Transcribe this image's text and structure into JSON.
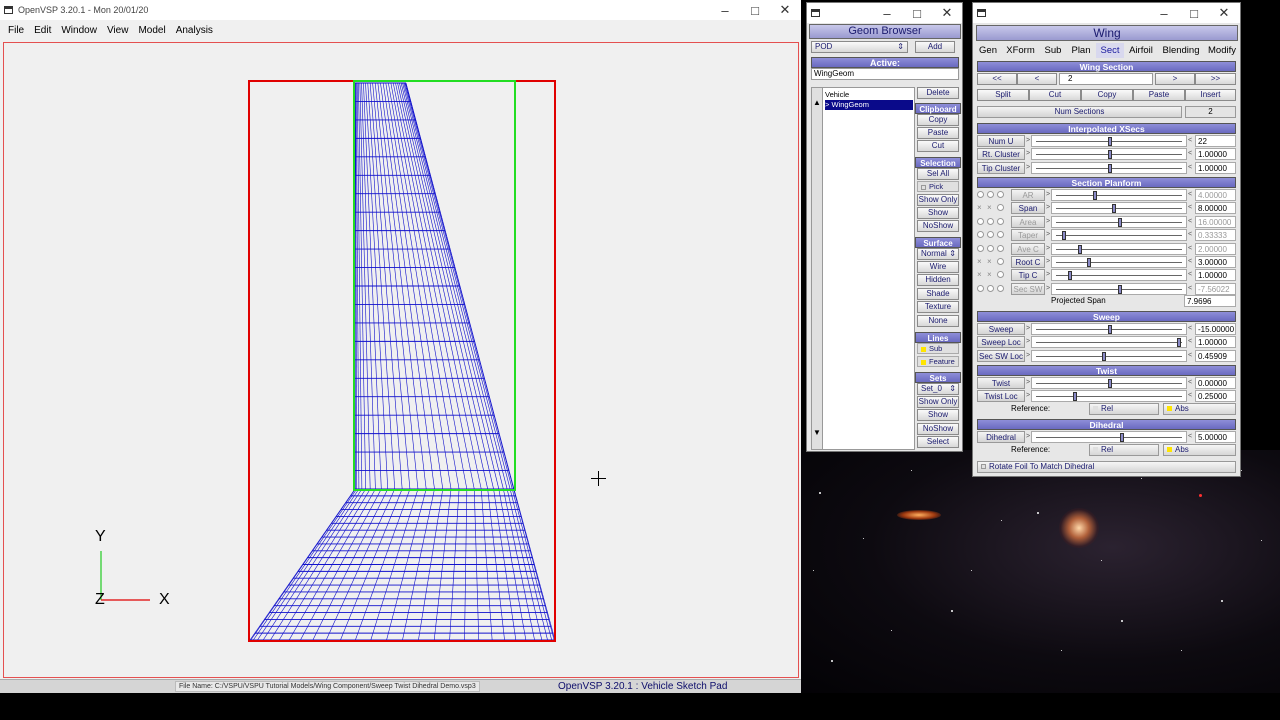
{
  "main_window": {
    "title": "OpenVSP 3.20.1 - Mon 20/01/20",
    "menu": [
      "File",
      "Edit",
      "Window",
      "View",
      "Model",
      "Analysis"
    ],
    "axis": {
      "y": "Y",
      "z": "Z",
      "x": "X"
    },
    "status_file": "File Name: C:/VSPU/VSPU Tutorial Models/Wing Component/Sweep Twist Dihedral Demo.vsp3",
    "status_title": "OpenVSP 3.20.1 : Vehicle Sketch Pad"
  },
  "geom_browser": {
    "title": "Geom Browser",
    "type_select": "POD",
    "add_label": "Add",
    "active_label": "Active:",
    "active_value": "WingGeom",
    "tree_items": [
      "Vehicle",
      "> WingGeom"
    ],
    "delete_label": "Delete",
    "clipboard": {
      "header": "Clipboard",
      "copy": "Copy",
      "paste": "Paste",
      "cut": "Cut"
    },
    "selection": {
      "header": "Selection",
      "sel_all": "Sel All",
      "pick": "Pick",
      "show_only": "Show Only",
      "show": "Show",
      "no_show": "NoShow"
    },
    "surface": {
      "header": "Surface",
      "mode": "Normal",
      "wire": "Wire",
      "hidden": "Hidden",
      "shade": "Shade",
      "texture": "Texture",
      "none": "None"
    },
    "lines": {
      "header": "Lines",
      "sub": "Sub",
      "feature": "Feature"
    },
    "sets": {
      "header": "Sets",
      "set_select": "Set_0",
      "show_only": "Show Only",
      "show": "Show",
      "no_show": "NoShow",
      "select": "Select"
    }
  },
  "wing": {
    "title": "Wing",
    "tabs": [
      "Gen",
      "XForm",
      "Sub",
      "Plan",
      "Sect",
      "Airfoil",
      "Blending",
      "Modify"
    ],
    "active_tab": "Sect",
    "wing_section": {
      "header": "Wing Section",
      "first": "<<",
      "prev": "<",
      "index": "2",
      "next": ">",
      "last": ">>"
    },
    "actions": [
      "Split",
      "Cut",
      "Copy",
      "Paste",
      "Insert"
    ],
    "num_sections": {
      "label": "Num Sections",
      "value": "2"
    },
    "interp_header": "Interpolated XSecs",
    "interp_rows": [
      {
        "label": "Num U",
        "value": "22",
        "pos": 0.5
      },
      {
        "label": "Rt. Cluster",
        "value": "1.00000",
        "pos": 0.5
      },
      {
        "label": "Tip Cluster",
        "value": "1.00000",
        "pos": 0.5
      }
    ],
    "planform_header": "Section Planform",
    "planform_rows": [
      {
        "label": "AR",
        "value": "4.00000",
        "pos": 0.3,
        "enabled": false,
        "radio": false
      },
      {
        "label": "Span",
        "value": "8.00000",
        "pos": 0.45,
        "enabled": true,
        "radio": true
      },
      {
        "label": "Area",
        "value": "16.00000",
        "pos": 0.5,
        "enabled": false,
        "radio": false
      },
      {
        "label": "Taper",
        "value": "0.33333",
        "pos": 0.05,
        "enabled": false,
        "radio": false
      },
      {
        "label": "Ave C",
        "value": "2.00000",
        "pos": 0.18,
        "enabled": false,
        "radio": false
      },
      {
        "label": "Root C",
        "value": "3.00000",
        "pos": 0.25,
        "enabled": true,
        "radio": true
      },
      {
        "label": "Tip C",
        "value": "1.00000",
        "pos": 0.1,
        "enabled": true,
        "radio": true
      },
      {
        "label": "Sec SW",
        "value": "-7.56022",
        "pos": 0.5,
        "enabled": false,
        "radio": false
      }
    ],
    "projected_span": {
      "label": "Projected Span",
      "value": "7.9696"
    },
    "sweep_header": "Sweep",
    "sweep_rows": [
      {
        "label": "Sweep",
        "value": "-15.00000",
        "pos": 0.5
      },
      {
        "label": "Sweep Loc",
        "value": "1.00000",
        "pos": 0.98
      },
      {
        "label": "Sec SW Loc",
        "value": "0.45909",
        "pos": 0.46
      }
    ],
    "twist_header": "Twist",
    "twist_rows": [
      {
        "label": "Twist",
        "value": "0.00000",
        "pos": 0.5
      },
      {
        "label": "Twist Loc",
        "value": "0.25000",
        "pos": 0.26
      }
    ],
    "twist_reference": {
      "label": "Reference:",
      "rel": "Rel",
      "abs": "Abs"
    },
    "dihedral_header": "Dihedral",
    "dihedral_row": {
      "label": "Dihedral",
      "value": "5.00000",
      "pos": 0.58
    },
    "dihedral_reference": {
      "label": "Reference:",
      "rel": "Rel",
      "abs": "Abs"
    },
    "rotate_foil": "Rotate Foil To Match Dihedral"
  }
}
